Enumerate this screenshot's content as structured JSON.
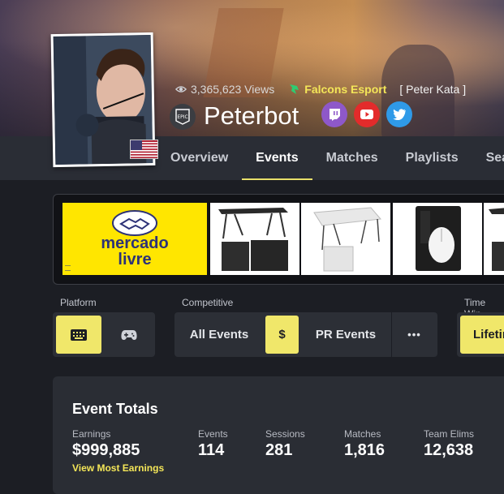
{
  "profile": {
    "views_text": "3,365,623 Views",
    "team": "Falcons Esport",
    "alias": "[ Peter Kata ]",
    "name": "Peterbot",
    "platform_icon": "epic-games-icon",
    "country_flag": "us-flag-icon",
    "social": [
      {
        "name": "twitch",
        "icon": "twitch-icon",
        "color": "#8e58c9"
      },
      {
        "name": "youtube",
        "icon": "youtube-icon",
        "color": "#e32b2b"
      },
      {
        "name": "twitter",
        "icon": "twitter-icon",
        "color": "#2f9ae8"
      }
    ]
  },
  "tabs": [
    {
      "label": "Overview",
      "active": false
    },
    {
      "label": "Events",
      "active": true
    },
    {
      "label": "Matches",
      "active": false
    },
    {
      "label": "Playlists",
      "active": false
    },
    {
      "label": "Seas",
      "active": false
    }
  ],
  "ad": {
    "brand_line1": "mercado",
    "brand_line2": "livre",
    "products": [
      "folding-table-black-icon",
      "folding-table-white-icon",
      "gaming-mouse-box-icon",
      "folding-table-partial-icon"
    ]
  },
  "filters": {
    "platform_label": "Platform",
    "platform_options": [
      "keyboard-icon",
      "gamepad-icon"
    ],
    "competitive_label": "Competitive",
    "all_events": "All Events",
    "dollar": "$",
    "pr_events": "PR Events",
    "more": "•••",
    "time_label": "Time Win",
    "time_value": "Lifetir"
  },
  "totals": {
    "title": "Event Totals",
    "link": "View Most Earnings",
    "stats": [
      {
        "label": "Earnings",
        "value": "$999,885"
      },
      {
        "label": "Events",
        "value": "114"
      },
      {
        "label": "Sessions",
        "value": "281"
      },
      {
        "label": "Matches",
        "value": "1,816"
      },
      {
        "label": "Team Elims",
        "value": "12,638"
      }
    ]
  },
  "colors": {
    "accent": "#f0e76a",
    "team": "#f4e658",
    "bg": "#1c1e24",
    "panel": "#2a2d34"
  }
}
